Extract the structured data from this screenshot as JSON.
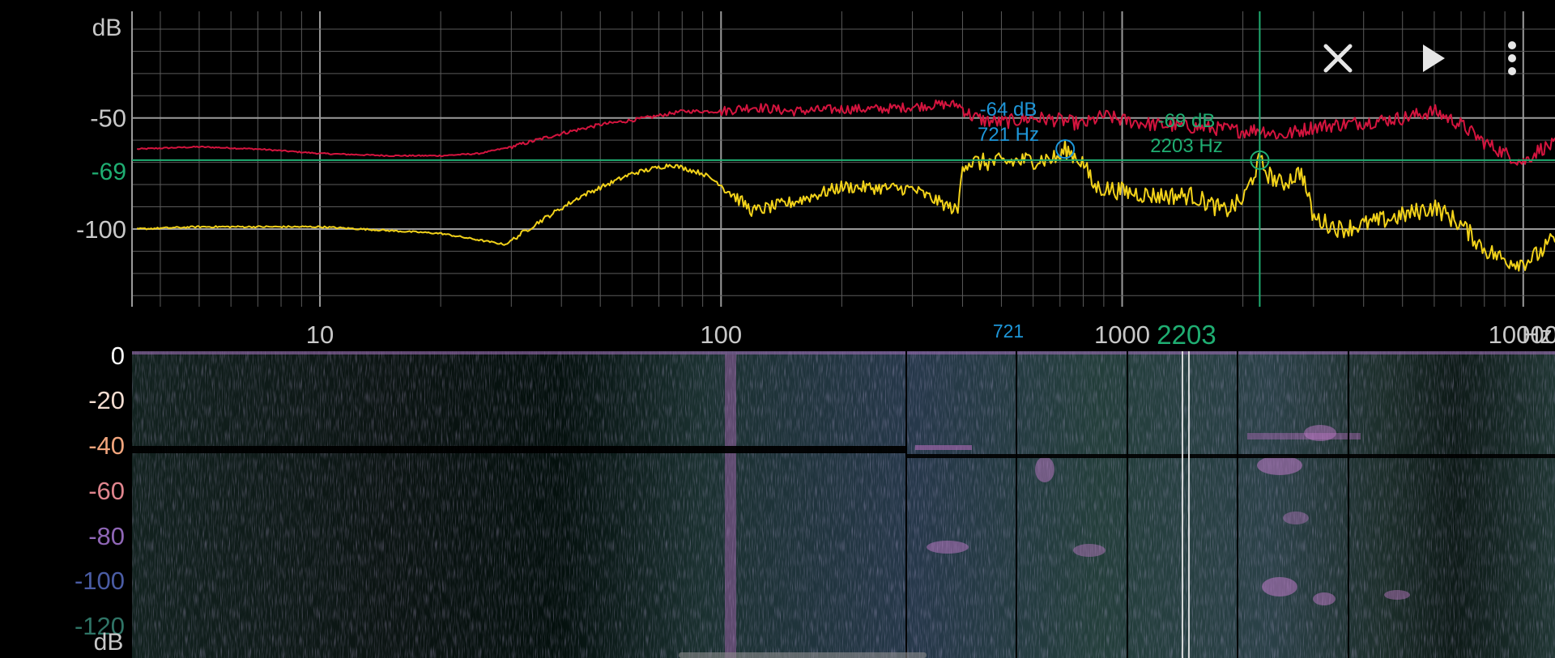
{
  "spectrum": {
    "db_unit": "dB",
    "hz_unit": "Hz",
    "y_ticks": [
      "-50",
      "-100"
    ],
    "x_ticks": [
      "10",
      "100",
      "1000",
      "10000"
    ],
    "cursor_a": {
      "db_label": "-64 dB",
      "hz_label": "721 Hz",
      "axis_label": "721"
    },
    "cursor_b": {
      "db_label": "-69 dB",
      "hz_label": "2203 Hz",
      "axis_label": "2203",
      "y_axis_label": "-69"
    }
  },
  "spectrogram": {
    "db_unit": "dB",
    "scale": [
      "0",
      "-20",
      "-40",
      "-60",
      "-80",
      "-100",
      "-120"
    ]
  },
  "toolbar": {
    "close_icon": "close-icon",
    "play_icon": "play-icon",
    "menu_icon": "more-vert-icon"
  },
  "colors": {
    "background": "#000000",
    "grid": "#5a5a5a",
    "trace_red": "#d4143e",
    "trace_yellow": "#f2d21a",
    "cursor_a": "#1e96d8",
    "cursor_b": "#1fae72",
    "axis_text": "#c8c8c8",
    "spectrogram_base": "#233e3a",
    "spectrogram_hot": "#b06ab8"
  },
  "chart_data": {
    "type": "line",
    "xscale": "log",
    "xlim": [
      3.4,
      12000
    ],
    "ylim": [
      -135,
      -2
    ],
    "xlabel": "Hz",
    "ylabel": "dB",
    "series": [
      {
        "color": "#d4143e",
        "x": [
          3.5,
          5,
          7,
          10,
          15,
          20,
          25,
          30,
          40,
          50,
          60,
          70,
          80,
          100,
          120,
          150,
          200,
          250,
          300,
          350,
          390,
          420,
          450,
          500,
          550,
          600,
          700,
          800,
          900,
          1000,
          1200,
          1500,
          1800,
          2000,
          2200,
          2500,
          3000,
          4000,
          5000,
          6000,
          7000,
          8000,
          9000,
          10000,
          11000,
          12000
        ],
        "y": [
          -64,
          -63,
          -64,
          -66,
          -67,
          -67,
          -66,
          -63,
          -57,
          -53,
          -51,
          -49,
          -47,
          -47,
          -45,
          -47,
          -46,
          -46,
          -45,
          -44,
          -44,
          -49,
          -51,
          -52,
          -51,
          -50,
          -51,
          -53,
          -49,
          -51,
          -53,
          -54,
          -55,
          -56,
          -55,
          -58,
          -54,
          -52,
          -50,
          -47,
          -53,
          -61,
          -66,
          -70,
          -64,
          -62
        ]
      },
      {
        "color": "#f2d21a",
        "x": [
          3.5,
          5,
          10,
          20,
          29,
          35,
          45,
          60,
          75,
          90,
          100,
          120,
          150,
          200,
          300,
          390,
          400,
          500,
          700,
          721,
          800,
          850,
          1000,
          1200,
          1500,
          1800,
          2000,
          2203,
          2300,
          2500,
          2800,
          3000,
          3500,
          4000,
          5000,
          6000,
          7000,
          8000,
          9000,
          10000,
          11000,
          12000
        ],
        "y": [
          -100,
          -99,
          -99,
          -102,
          -107,
          -97,
          -85,
          -75,
          -71,
          -75,
          -80,
          -92,
          -88,
          -81,
          -82,
          -92,
          -70,
          -70,
          -68,
          -64,
          -70,
          -81,
          -83,
          -85,
          -85,
          -92,
          -87,
          -69,
          -75,
          -80,
          -74,
          -95,
          -100,
          -98,
          -94,
          -90,
          -98,
          -109,
          -114,
          -115,
          -111,
          -104
        ]
      }
    ],
    "cursors": [
      {
        "x": 721,
        "y": -64
      },
      {
        "x": 2203,
        "y": -69
      }
    ]
  }
}
